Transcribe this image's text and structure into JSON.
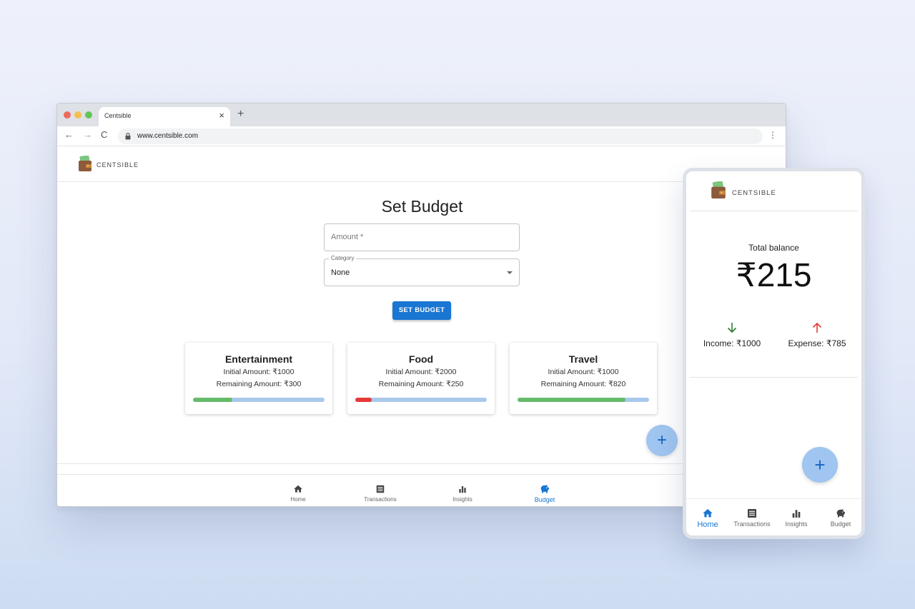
{
  "browser": {
    "tab_title": "Centsible",
    "tab_close": "×",
    "new_tab": "+",
    "back": "←",
    "forward": "→",
    "reload": "C",
    "url": "www.centsible.com",
    "menu": "⋮"
  },
  "brand": "CENTSIBLE",
  "budget_page": {
    "title": "Set Budget",
    "amount_placeholder": "Amount *",
    "category_label": "Category",
    "category_value": "None",
    "submit_label": "SET BUDGET",
    "cards": [
      {
        "name": "Entertainment",
        "initial": "Initial Amount: ₹1000",
        "remaining": "Remaining Amount: ₹300",
        "progress": 0.3,
        "bar_color": "#66bb6a"
      },
      {
        "name": "Food",
        "initial": "Initial Amount: ₹2000",
        "remaining": "Remaining Amount: ₹250",
        "progress": 0.125,
        "bar_color": "#e53935"
      },
      {
        "name": "Travel",
        "initial": "Initial Amount: ₹1000",
        "remaining": "Remaining Amount: ₹820",
        "progress": 0.82,
        "bar_color": "#66bb6a"
      }
    ]
  },
  "fab_label": "+",
  "nav": [
    {
      "label": "Home",
      "icon": "home-icon"
    },
    {
      "label": "Transactions",
      "icon": "list-icon"
    },
    {
      "label": "Insights",
      "icon": "bar-chart-icon"
    },
    {
      "label": "Budget",
      "icon": "piggy-bank-icon"
    }
  ],
  "desktop_active_nav": "Budget",
  "phone": {
    "total_label": "Total balance",
    "total_value": "₹215",
    "income": "Income: ₹1000",
    "expense": "Expense: ₹785",
    "active_nav": "Home"
  },
  "colors": {
    "primary": "#1976d2",
    "fab": "#9fc5f0",
    "progress_track": "#a9c9ec",
    "income_arrow": "#2e7d32",
    "expense_arrow": "#e53935"
  }
}
